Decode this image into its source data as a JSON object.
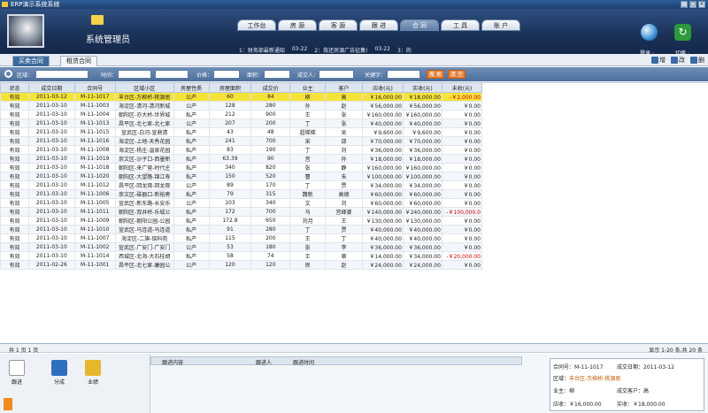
{
  "window": {
    "title": "ERP演示系统系统",
    "min": "_",
    "max": "□",
    "close": "×"
  },
  "header": {
    "system_title": "系统管理员",
    "marquee": [
      "1：财务部最新通知",
      "03-22",
      "2：我还房源广告征集!",
      "03-22",
      "3：的"
    ],
    "login_label": "登录 ·",
    "switch_label": "切换 ·"
  },
  "nav": [
    {
      "label": "工作台"
    },
    {
      "label": "房 源"
    },
    {
      "label": "客 源"
    },
    {
      "label": "跟 进"
    },
    {
      "label": "合 同",
      "active": true
    },
    {
      "label": "工 具"
    },
    {
      "label": "账 户"
    }
  ],
  "subtabs": [
    {
      "label": "买卖合同",
      "active": true
    },
    {
      "label": "租赁合同"
    }
  ],
  "actions": [
    {
      "label": "增"
    },
    {
      "label": "改"
    },
    {
      "label": "删"
    }
  ],
  "filter": {
    "area": "区域：",
    "time": "时间：",
    "price": "价格：",
    "size": "面积：",
    "deal_person": "成交人：",
    "keyword": "关键字：",
    "search": "搜 索",
    "clear": "清 空"
  },
  "columns": [
    "状态",
    "成交日期",
    "合同号",
    "区域小区",
    "房屋性质",
    "房屋面积",
    "成交价",
    "业主",
    "客户",
    "应收(元)",
    "实收(元)",
    "未收(元)"
  ],
  "rows": [
    [
      "有效",
      "2011-03-12",
      "M-11-1017",
      "丰台区-万柳桥-桃源居",
      "公产",
      "60",
      "84",
      "柳",
      "高",
      "￥16,000.00",
      "￥18,000.00",
      "-￥2,000.00"
    ],
    [
      "有效",
      "2011-03-10",
      "M-11-1003",
      "海淀区-清河-清河新城",
      "公产",
      "128",
      "280",
      "孙",
      "赵",
      "￥56,000.00",
      "￥56,000.00",
      "￥0.00"
    ],
    [
      "有效",
      "2011-03-10",
      "M-11-1004",
      "朝阳区-亦大桥-世界城",
      "私产",
      "212",
      "900",
      "王",
      "张",
      "￥160,000.00",
      "￥160,000.00",
      "￥0.00"
    ],
    [
      "有效",
      "2011-03-10",
      "M-11-1013",
      "昌平区-北七家-北七家",
      "公产",
      "207",
      "200",
      "丁",
      "张",
      "￥40,000.00",
      "￥40,000.00",
      "￥0.00"
    ],
    [
      "有效",
      "2011-03-10",
      "M-11-1015",
      "宣武区-白河-宣鼎清",
      "私产",
      "43",
      "48",
      "超梯梯",
      "吴",
      "￥9,600.00",
      "￥9,600.00",
      "￥0.00"
    ],
    [
      "有效",
      "2011-03-10",
      "M-11-1016",
      "海淀区-上地-天秀花园",
      "私产",
      "241",
      "700",
      "宋",
      "邵",
      "￥70,000.00",
      "￥70,000.00",
      "￥0.00"
    ],
    [
      "有效",
      "2011-03-10",
      "M-11-1008",
      "海淀区-杨庄-温泉花园",
      "私产",
      "83",
      "190",
      "丁",
      "刘",
      "￥36,000.00",
      "￥36,000.00",
      "￥0.00"
    ],
    [
      "有效",
      "2011-03-10",
      "M-11-1019",
      "崇文区-沙子口-西墨新",
      "私产",
      "63.39",
      "90",
      "宫",
      "孙",
      "￥18,000.00",
      "￥18,000.00",
      "￥0.00"
    ],
    [
      "有效",
      "2011-03-10",
      "M-11-1018",
      "朝阳区-来广营-时代庄",
      "私产",
      "340",
      "820",
      "张",
      "静",
      "￥160,000.00",
      "￥160,000.00",
      "￥0.00"
    ],
    [
      "有效",
      "2011-03-10",
      "M-11-1020",
      "朝阳区-大望路-锦江寿",
      "私产",
      "150",
      "520",
      "曹",
      "朱",
      "￥100,000.00",
      "￥100,000.00",
      "￥0.00"
    ],
    [
      "有效",
      "2011-03-10",
      "M-11-1012",
      "昌平区-回龙观-回龙观",
      "公产",
      "89",
      "170",
      "丁",
      "贾",
      "￥34,000.00",
      "￥34,000.00",
      "￥0.00"
    ],
    [
      "有效",
      "2011-03-10",
      "M-11-1006",
      "崇文区-磁器口-新裕寄",
      "私产",
      "79",
      "315",
      "魏新",
      "高德",
      "￥60,000.00",
      "￥60,000.00",
      "￥0.00"
    ],
    [
      "有效",
      "2011-03-10",
      "M-11-1005",
      "宣武区-新东路-长安乐",
      "公产",
      "103",
      "340",
      "文",
      "刘",
      "￥60,000.00",
      "￥60,000.00",
      "￥0.00"
    ],
    [
      "有效",
      "2011-03-10",
      "M-11-1011",
      "朝阳区-双井桥-乐城公",
      "私产",
      "172",
      "700",
      "马",
      "宫峰婆",
      "￥140,000.00",
      "￥240,000.00",
      "-￥100,000.0"
    ],
    [
      "有效",
      "2011-03-10",
      "M-11-1009",
      "朝阳区-朝阳公园-公园",
      "私产",
      "172.8",
      "650",
      "刘月",
      "王",
      "￥130,000.00",
      "￥130,000.00",
      "￥0.00"
    ],
    [
      "有效",
      "2011-03-10",
      "M-11-1010",
      "宣武区-马连道-马连道",
      "私产",
      "91",
      "280",
      "丁",
      "贾",
      "￥40,000.00",
      "￥40,000.00",
      "￥0.00"
    ],
    [
      "有效",
      "2011-03-10",
      "M-11-1007",
      "海淀区-二旗-铭科苑",
      "私产",
      "115",
      "200",
      "王",
      "丁",
      "￥40,000.00",
      "￥40,000.00",
      "￥0.00"
    ],
    [
      "有效",
      "2011-03-10",
      "M-11-1002",
      "宣武区-广安门-广安门",
      "公产",
      "53",
      "180",
      "张",
      "李",
      "￥36,000.00",
      "￥36,000.00",
      "￥0.00"
    ],
    [
      "有效",
      "2011-03-10",
      "M-11-1014",
      "西城区-北海-大石桂胡",
      "私产",
      "58",
      "74",
      "王",
      "章",
      "￥14,000.00",
      "￥34,000.00",
      "-￥20,000.00"
    ],
    [
      "有效",
      "2011-02-26",
      "M-11-1001",
      "昌平区-北七家-康园公",
      "公产",
      "120",
      "120",
      "房",
      "赵",
      "￥24,000.00",
      "￥24,000.00",
      "￥0.00"
    ]
  ],
  "pager": {
    "left": "共 1 页 1 页",
    "right": "显示 1-20 条,共 20 条"
  },
  "bottom": {
    "tools": [
      "跟进",
      "分成",
      "业绩"
    ],
    "follow_cols": [
      "跟进内容",
      "跟进人",
      "跟进时间"
    ]
  },
  "card": {
    "contract_label": "合同号：",
    "contract": "M-11-1017",
    "date_label": "成交日期：",
    "date": "2011-03-12",
    "area_label": "区域：",
    "area": "丰台区-万柳桥-桃源居",
    "owner_label": "业主：",
    "owner": "柳",
    "client_label": "成交客户：",
    "client": "高",
    "due_label": "应收：",
    "due": "￥16,000.00",
    "paid_label": "实收：",
    "paid": "￥18,000.00"
  }
}
